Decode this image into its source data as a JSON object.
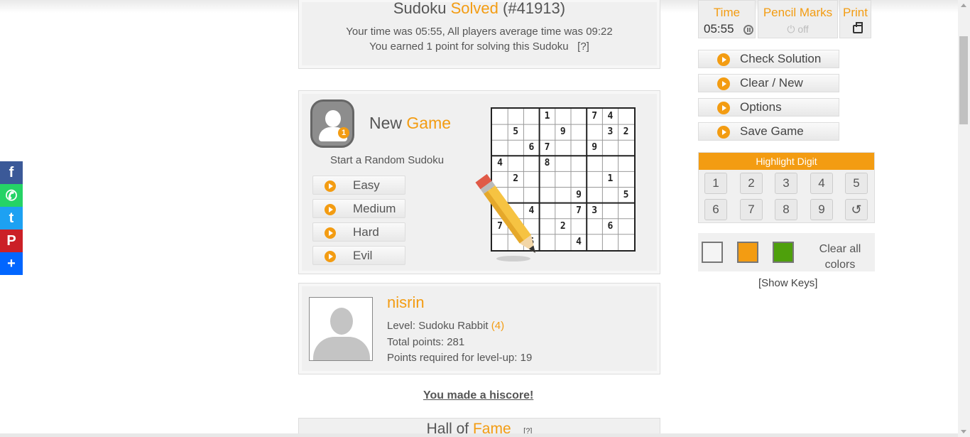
{
  "solved": {
    "word1": "Sudoku",
    "word2": "Solved",
    "puzzle_id": "(#41913)",
    "time_line": "Your time was 05:55, All players average time was 09:22",
    "points_line": "You earned 1 point for solving this Sudoku",
    "help": "[?]"
  },
  "new_game": {
    "badge_number": "1",
    "title_word1": "New",
    "title_word2": "Game",
    "subtitle": "Start a Random Sudoku",
    "difficulties": [
      "Easy",
      "Medium",
      "Hard",
      "Evil"
    ]
  },
  "preview_grid": [
    [
      "",
      "",
      "",
      "1",
      "",
      "",
      "7",
      "4",
      ""
    ],
    [
      "",
      "5",
      "",
      "",
      "9",
      "",
      "",
      "3",
      "2"
    ],
    [
      "",
      "",
      "6",
      "7",
      "",
      "",
      "9",
      "",
      ""
    ],
    [
      "4",
      "",
      "",
      "8",
      "",
      "",
      "",
      "",
      ""
    ],
    [
      "",
      "2",
      "",
      "",
      "",
      "",
      "",
      "1",
      ""
    ],
    [
      "",
      "",
      "",
      "",
      "",
      "9",
      "",
      "",
      "5"
    ],
    [
      "",
      "",
      "4",
      "",
      "",
      "7",
      "3",
      "",
      ""
    ],
    [
      "7",
      "3",
      "",
      "",
      "2",
      "",
      "",
      "6",
      ""
    ],
    [
      "",
      "",
      "5",
      "",
      "",
      "4",
      "",
      "",
      ""
    ]
  ],
  "profile": {
    "username": "nisrin",
    "level_label": "Level: Sudoku Rabbit",
    "level_num": "(4)",
    "total_points": "Total points: 281",
    "points_required": "Points required for level-up: 19"
  },
  "hiscore": "You made a hiscore!",
  "hall_of_fame": {
    "word1": "Hall of",
    "word2": "Fame",
    "help": "[?]"
  },
  "controls": {
    "time_label": "Time",
    "time_value": "05:55",
    "pencil_label": "Pencil Marks",
    "pencil_state": "off",
    "print_label": "Print"
  },
  "actions": [
    "Check Solution",
    "Clear / New",
    "Options",
    "Save Game"
  ],
  "highlight": {
    "title": "Highlight Digit",
    "digits": [
      "1",
      "2",
      "3",
      "4",
      "5",
      "6",
      "7",
      "8",
      "9"
    ],
    "undo": "↺"
  },
  "colors": {
    "swatches": [
      "#f4f4f4",
      "#f39c12",
      "#4ea00c"
    ],
    "clear_label": "Clear all colors"
  },
  "show_keys": "[Show Keys]",
  "social": [
    "f",
    "✆",
    "t",
    "P",
    "+"
  ],
  "social_icons": [
    "facebook-icon",
    "whatsapp-icon",
    "twitter-icon",
    "pinterest-icon",
    "share-plus-icon"
  ]
}
